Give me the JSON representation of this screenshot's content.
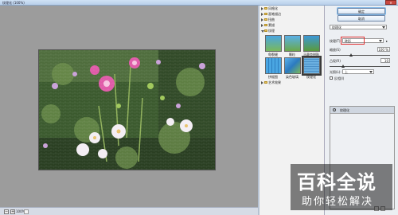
{
  "window": {
    "title": "纹理化 (100%)"
  },
  "statusbar": {
    "zoom": "100%"
  },
  "gallery": {
    "categories": [
      {
        "label": "风格化",
        "open": false
      },
      {
        "label": "画笔描边",
        "open": false
      },
      {
        "label": "扭曲",
        "open": false
      },
      {
        "label": "素描",
        "open": false
      },
      {
        "label": "纹理",
        "open": true
      },
      {
        "label": "艺术效果",
        "open": false
      }
    ],
    "thumbs": [
      {
        "label": "龟裂缝",
        "selected": false
      },
      {
        "label": "颗粒",
        "selected": false
      },
      {
        "label": "马赛克拼贴",
        "selected": false
      },
      {
        "label": "拼缀图",
        "selected": false
      },
      {
        "label": "染色玻璃",
        "selected": false
      },
      {
        "label": "纹理化",
        "selected": true
      }
    ]
  },
  "buttons": {
    "ok": "确定",
    "cancel": "取消"
  },
  "settings": {
    "filter_select": "纹理化",
    "texture_label": "纹理(T):",
    "texture_value": "砖形",
    "scale_label": "缩放(S)",
    "scale_value": "100 %",
    "scale_percent": 100,
    "relief_label": "凸现(R)",
    "relief_value": "10",
    "relief_fraction": 0.2,
    "light_label": "光照(L):",
    "light_value": "上",
    "invert_label": "反相(I)",
    "invert_checked": false
  },
  "layers": {
    "row": "纹理化"
  },
  "watermark": {
    "big": "百科全说",
    "small": "助你轻松解决"
  }
}
